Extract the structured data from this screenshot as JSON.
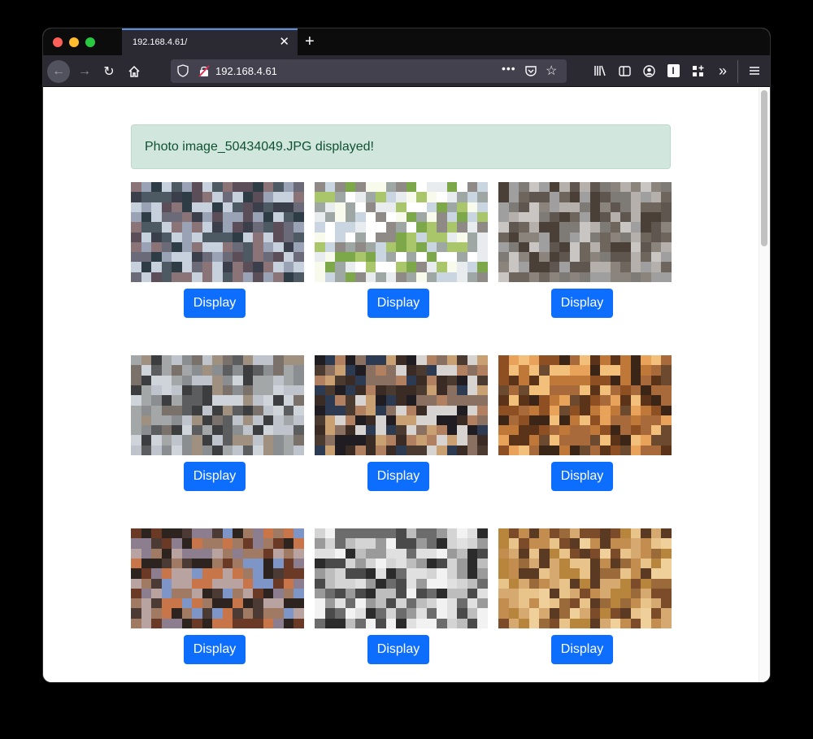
{
  "browser": {
    "tab_title": "192.168.4.61/",
    "url": "192.168.4.61",
    "icons": {
      "back": "back-arrow-icon",
      "forward": "forward-arrow-icon",
      "reload": "reload-icon",
      "home": "home-icon",
      "tracking": "shield-icon",
      "insecure": "insecure-lock-icon",
      "more": "more-icon",
      "pocket": "pocket-icon",
      "bookmark": "star-icon",
      "library": "library-icon",
      "sidebar": "sidebar-icon",
      "account": "account-icon",
      "onepassword": "1password-icon",
      "extensions": "extensions-icon",
      "overflow": "overflow-chevron-icon",
      "menu": "hamburger-menu-icon"
    }
  },
  "alert": {
    "message": "Photo image_50434049.JPG displayed!",
    "bg": "#d1e7dd",
    "text_color": "#0f5132"
  },
  "photos": [
    {
      "button": "Display",
      "palette": [
        "#8a7478",
        "#5c4e58",
        "#3b3f4c",
        "#6b6a78",
        "#9aa3b5",
        "#c7d0dd",
        "#2e3d45",
        "#4d5a64"
      ]
    },
    {
      "button": "Display",
      "palette": [
        "#f8fbec",
        "#ffffff",
        "#c9d6e2",
        "#9ea7a3",
        "#a9c66b",
        "#7da84a",
        "#e9ecef",
        "#8f8a86"
      ]
    },
    {
      "button": "Display",
      "palette": [
        "#a09fa0",
        "#7e7a76",
        "#5f574f",
        "#8b847c",
        "#c8c5c3",
        "#4b4038",
        "#6e665d",
        "#b5b0ab"
      ]
    },
    {
      "button": "Display",
      "palette": [
        "#bfc4cc",
        "#8b8e90",
        "#5b5d5e",
        "#3b3d3f",
        "#a4a7a8",
        "#cfd3da",
        "#7a726a",
        "#9f9080"
      ]
    },
    {
      "button": "Display",
      "palette": [
        "#4a3a30",
        "#8a7060",
        "#d7d3d0",
        "#1f1d22",
        "#b08060",
        "#2d3b52",
        "#c9a071",
        "#3a2c24"
      ]
    },
    {
      "button": "Display",
      "palette": [
        "#5a3318",
        "#8e4f22",
        "#c07838",
        "#e9a25a",
        "#3a2517",
        "#a86a3a",
        "#f3c07c",
        "#6b4a30"
      ]
    },
    {
      "button": "Display",
      "palette": [
        "#6b3a26",
        "#c8754a",
        "#2e241f",
        "#8c7d8f",
        "#7e95c8",
        "#a07a62",
        "#4c3a35",
        "#b9a3a0"
      ]
    },
    {
      "button": "Display",
      "palette": [
        "#f2f2f2",
        "#bdbdbd",
        "#6c6c6c",
        "#2b2b2b",
        "#9a9a9a",
        "#e0e0e0",
        "#4a4a4a",
        "#d4d4d4"
      ]
    },
    {
      "button": "Display",
      "palette": [
        "#d6a970",
        "#9a6a3a",
        "#5a3a22",
        "#c38d50",
        "#e8c48a",
        "#b8853c",
        "#7b4b2a",
        "#f0d09a"
      ]
    }
  ],
  "colors": {
    "button_bg": "#0d6efd",
    "button_text": "#ffffff"
  }
}
